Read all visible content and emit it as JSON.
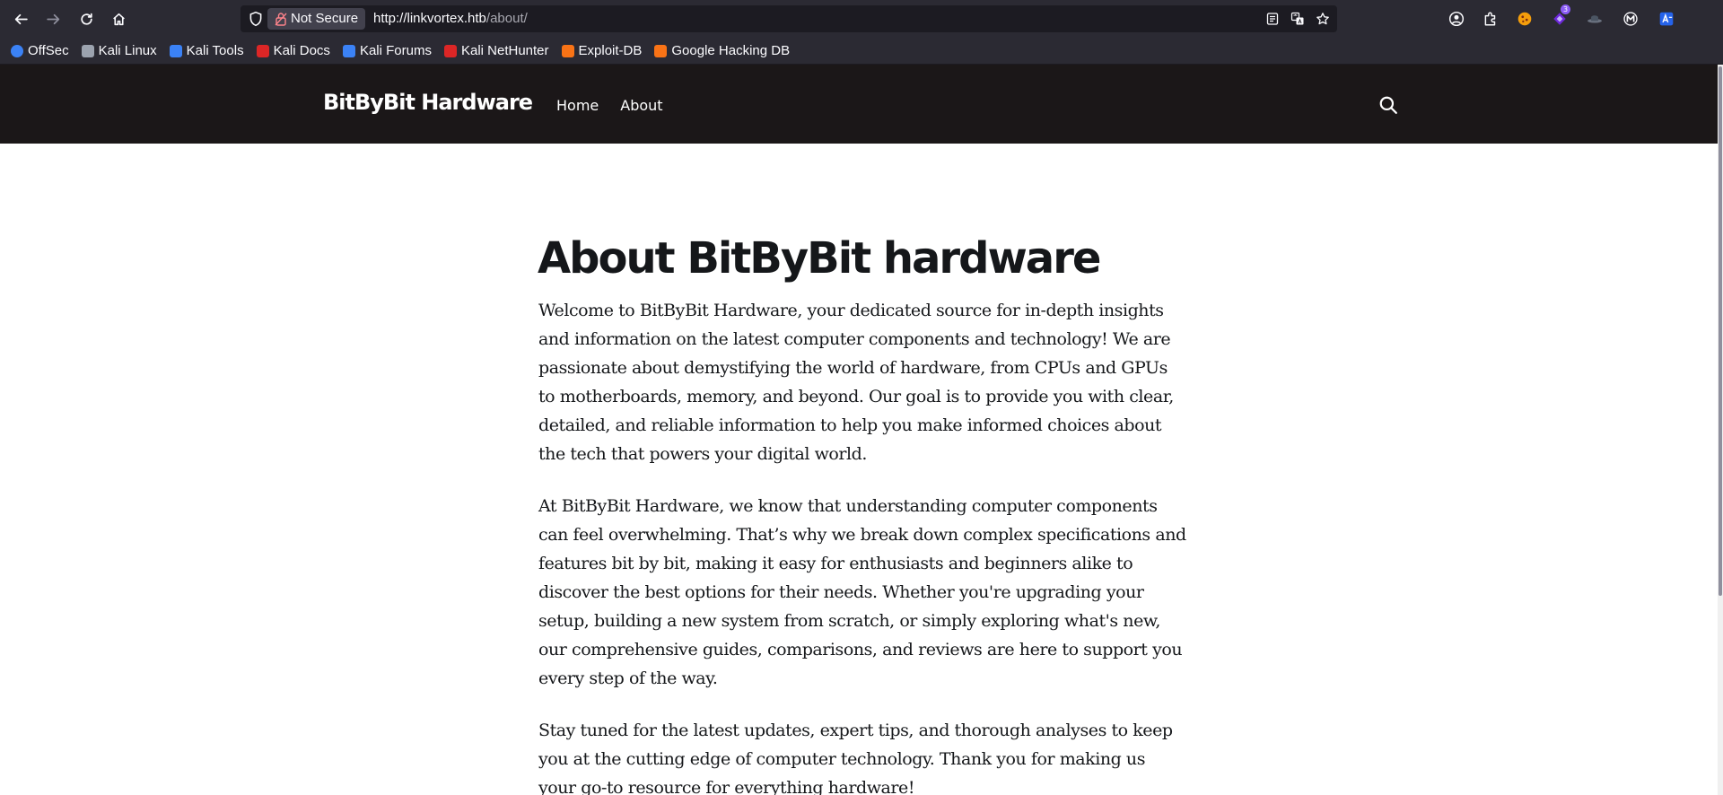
{
  "browser": {
    "security_label": "Not Secure",
    "url_host": "http://linkvortex.htb",
    "url_path": "/about/",
    "extension_badge": "3"
  },
  "bookmarks": [
    {
      "label": "OffSec",
      "color": "#3b82f6"
    },
    {
      "label": "Kali Linux",
      "color": "#9ca3af"
    },
    {
      "label": "Kali Tools",
      "color": "#3b82f6"
    },
    {
      "label": "Kali Docs",
      "color": "#dc2626"
    },
    {
      "label": "Kali Forums",
      "color": "#3b82f6"
    },
    {
      "label": "Kali NetHunter",
      "color": "#dc2626"
    },
    {
      "label": "Exploit-DB",
      "color": "#f97316"
    },
    {
      "label": "Google Hacking DB",
      "color": "#f97316"
    }
  ],
  "site": {
    "logo": "BitByBit Hardware",
    "nav": [
      "Home",
      "About"
    ]
  },
  "article": {
    "title": "About BitByBit hardware",
    "paragraphs": [
      "Welcome to BitByBit Hardware, your dedicated source for in-depth insights and information on the latest computer components and technology! We are passionate about demystifying the world of hardware, from CPUs and GPUs to motherboards, memory, and beyond. Our goal is to provide you with clear, detailed, and reliable information to help you make informed choices about the tech that powers your digital world.",
      "At BitByBit Hardware, we know that understanding computer components can feel overwhelming. That’s why we break down complex specifications and features bit by bit, making it easy for enthusiasts and beginners alike to discover the best options for their needs. Whether you're upgrading your setup, building a new system from scratch, or simply exploring what's new, our comprehensive guides, comparisons, and reviews are here to support you every step of the way.",
      "Stay tuned for the latest updates, expert tips, and thorough analyses to keep you at the cutting edge of computer technology. Thank you for making us your go-to resource for everything hardware!"
    ]
  },
  "colors": {
    "browser_chrome": "#2b2a33",
    "header_bg": "#1b1718",
    "text": "#15171a"
  }
}
